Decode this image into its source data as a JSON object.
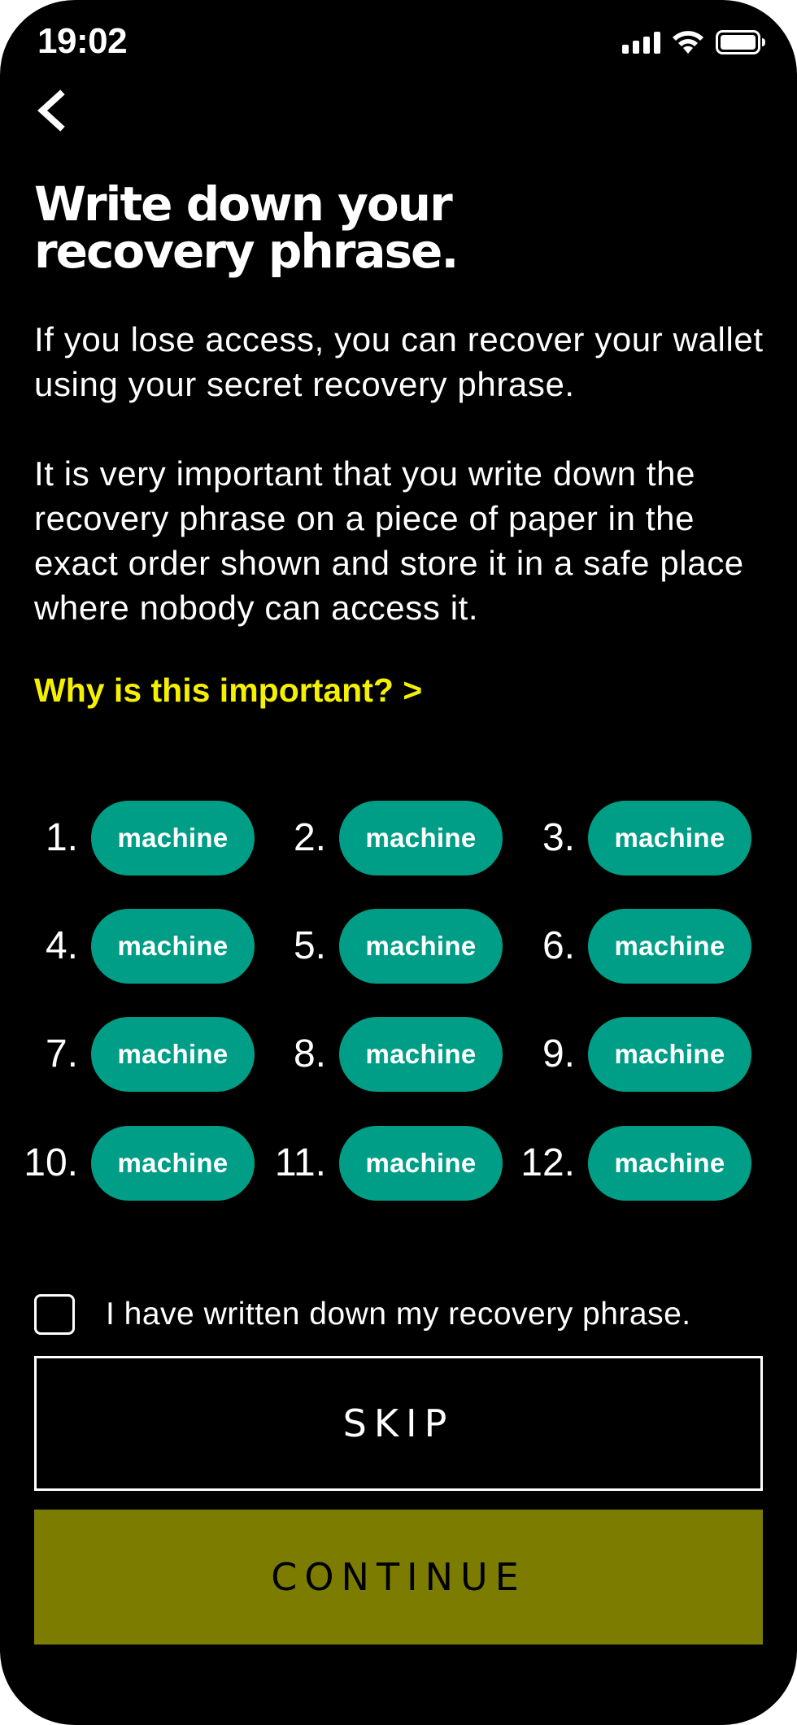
{
  "status_bar": {
    "time": "19:02",
    "icons": [
      "cellular-signal-icon",
      "wifi-icon",
      "battery-icon"
    ]
  },
  "nav": {
    "back_icon": "chevron-left-icon"
  },
  "header": {
    "title": "Write down your\nrecovery phrase."
  },
  "body": {
    "paragraph_1": "If you lose access, you can recover your wallet using your secret recovery phrase.",
    "paragraph_2": "It is very important that you write down the recovery phrase on a piece of paper in the exact order shown and store it in a safe place where nobody can access it.",
    "why_link": "Why is this important? >"
  },
  "recovery_words": [
    {
      "index": "1.",
      "word": "machine"
    },
    {
      "index": "2.",
      "word": "machine"
    },
    {
      "index": "3.",
      "word": "machine"
    },
    {
      "index": "4.",
      "word": "machine"
    },
    {
      "index": "5.",
      "word": "machine"
    },
    {
      "index": "6.",
      "word": "machine"
    },
    {
      "index": "7.",
      "word": "machine"
    },
    {
      "index": "8.",
      "word": "machine"
    },
    {
      "index": "9.",
      "word": "machine"
    },
    {
      "index": "10.",
      "word": "machine"
    },
    {
      "index": "11.",
      "word": "machine"
    },
    {
      "index": "12.",
      "word": "machine"
    }
  ],
  "confirm": {
    "label": "I have written down my recovery phrase.",
    "checked": false
  },
  "actions": {
    "skip_label": "SKIP",
    "continue_label": "CONTINUE"
  },
  "colors": {
    "background": "#000000",
    "accent_link": "#f5f000",
    "word_pill": "#009e86",
    "continue_button": "#7c7c00"
  }
}
